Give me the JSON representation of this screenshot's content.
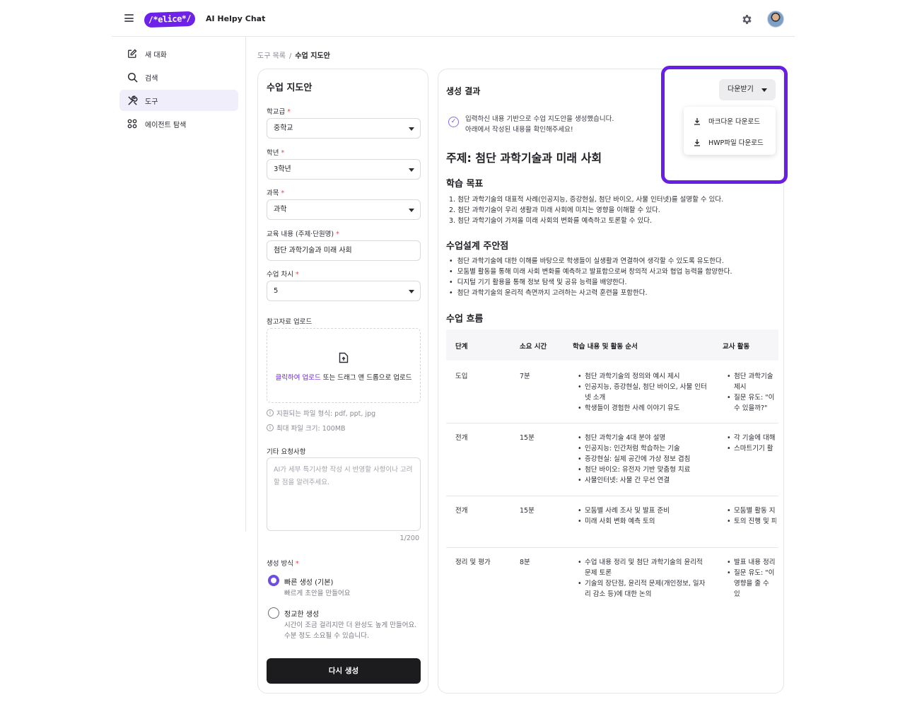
{
  "header": {
    "logo_text": "/*elice*/",
    "app_title": "AI Helpy Chat",
    "brand_color": "#6e21e8"
  },
  "nav": {
    "items": [
      {
        "label": "새 대화",
        "icon": "edit-icon"
      },
      {
        "label": "검색",
        "icon": "search-icon"
      },
      {
        "label": "도구",
        "icon": "tools-icon"
      },
      {
        "label": "에이전트 탐색",
        "icon": "grid-icon"
      }
    ]
  },
  "breadcrumb": {
    "parent": "도구 목록",
    "sep": "/",
    "current": "수업 지도안"
  },
  "form": {
    "title": "수업 지도안",
    "school_level": {
      "label": "학교급",
      "value": "중학교"
    },
    "grade": {
      "label": "학년",
      "value": "3학년"
    },
    "subject": {
      "label": "과목",
      "value": "과학"
    },
    "content": {
      "label": "교육 내용 (주제·단원명)",
      "value": "첨단 과학기술과 미래 사회"
    },
    "session": {
      "label": "수업 차시",
      "value": "5"
    },
    "upload": {
      "label": "참고자료 업로드",
      "link_text": "클릭하여 업로드",
      "rest_text": " 또는 드래그 앤 드롭으로 업로드",
      "formats": "지원되는 파일 형식: pdf, ppt, jpg",
      "max_size": "최대 파일 크기: 100MB"
    },
    "requests": {
      "label": "기타 요청사항",
      "placeholder": "AI가 세부 특기사항 작성 시 반영할 사항이나 고려할 점을 알려주세요.",
      "counter": "1/200"
    },
    "mode": {
      "label": "생성 방식",
      "fast_title": "빠른 생성 (기본)",
      "fast_desc": "빠르게 초안을 만들어요",
      "precise_title": "정교한 생성",
      "precise_desc_1": "시간이 조금 걸리지만 더 완성도 높게 만들어요.",
      "precise_desc_2": "수분 정도 소요될 수 있습니다."
    },
    "regen_label": "다시 생성"
  },
  "result": {
    "title": "생성 결과",
    "notice_1": "입력하신 내용 기반으로 수업 지도안을 생성했습니다.",
    "notice_2": "아래에서 작성된 내용을 확인해주세요!",
    "topic": "주제: 첨단 과학기술과 미래 사회",
    "goals_title": "학습 목표",
    "goals": [
      "1. 첨단 과학기술의 대표적 사례(인공지능, 증강현실, 첨단 바이오, 사물 인터넷)를 설명할 수 있다.",
      "2. 첨단 과학기술이 우리 생활과 미래 사회에 미치는 영향을 이해할 수 있다.",
      "3. 첨단 과학기술이 가져올 미래 사회의 변화를 예측하고 토론할 수 있다."
    ],
    "notes_title": "수업설계 주안점",
    "notes": [
      "첨단 과학기술에 대한 이해를 바탕으로 학생들이 실생활과 연결하여 생각할 수 있도록 유도한다.",
      "모둠별 활동을 통해 미래 사회 변화를 예측하고 발표함으로써 창의적 사고와 협업 능력을 함양한다.",
      "디지털 기기 활용을 통해 정보 탐색 및 공유 능력을 배양한다.",
      "첨단 과학기술의 윤리적 측면까지 고려하는 사고력 훈련을 포함한다."
    ],
    "flow_title": "수업 흐름",
    "table": {
      "headers": [
        "단계",
        "소요 시간",
        "학습 내용 및 활동 순서",
        "교사 활동"
      ],
      "rows": [
        {
          "stage": "도입",
          "time": "7분",
          "content": [
            "첨단 과학기술의 정의와 예시 제시",
            "인공지능, 증강현실, 첨단 바이오, 사물 인터넷 소개",
            "학생들이 경험한 사례 이야기 유도"
          ],
          "teacher": [
            "첨단 과학기술 제시",
            "질문 유도: \"이 수 있을까?\""
          ]
        },
        {
          "stage": "전개",
          "time": "15분",
          "content": [
            "첨단 과학기술 4대 분야 설명",
            "인공지능: 인간처럼 학습하는 기술",
            "증강현실: 실제 공간에 가상 정보 겹침",
            "첨단 바이오: 유전자 기반 맞춤형 치료",
            "사물인터넷: 사물 간 무선 연결"
          ],
          "teacher": [
            "각 기술에 대해",
            "스마트기기 활"
          ]
        },
        {
          "stage": "전개",
          "time": "15분",
          "content": [
            "모둠별 사례 조사 및 발표 준비",
            "미래 사회 변화 예측 토의"
          ],
          "teacher": [
            "모둠별 활동 지",
            "토의 진행 및 피"
          ]
        },
        {
          "stage": "정리 및 평가",
          "time": "8분",
          "content": [
            "수업 내용 정리 및 첨단 과학기술의 윤리적 문제 토론",
            "기술의 장단점, 윤리적 문제(개인정보, 일자리 감소 등)에 대한 논의"
          ],
          "teacher": [
            "발표 내용 정리",
            "질문 유도: \"이 영향을 줄 수 있"
          ]
        }
      ]
    }
  },
  "download": {
    "button_label": "다운받기",
    "items": [
      "마크다운 다운로드",
      "HWP파일 다운로드"
    ],
    "highlight_color": "#6a1de6"
  }
}
